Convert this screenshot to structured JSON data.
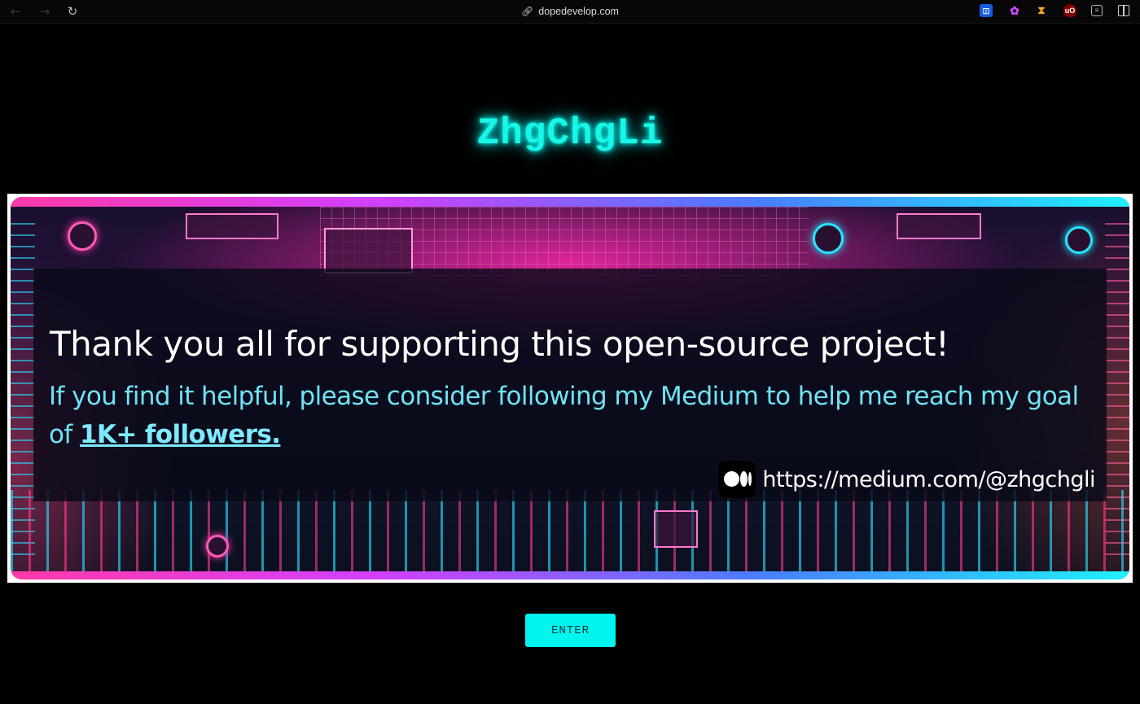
{
  "browser": {
    "back_icon": "arrow-left-icon",
    "forward_icon": "arrow-right-icon",
    "reload_icon": "reload-icon",
    "url": "dopedevelop.com",
    "extensions": [
      "bitwarden-icon",
      "brain-icon",
      "rss-icon",
      "ublock-icon",
      "extensions-icon",
      "sidebar-icon"
    ],
    "ublock_label": "uO"
  },
  "page": {
    "title": "ZhgChgLi",
    "title_color": "#19f5e6",
    "background": "#000000"
  },
  "banner": {
    "headline": "Thank you all for supporting this open-source project!",
    "subline": "If you find it helpful, please consider following my Medium to help me reach my goal of",
    "subline_emphasis": "1K+ followers.",
    "medium_url": "https://medium.com/@zhgchgli",
    "accent_pink": "#ff3aa8",
    "accent_cyan": "#1ef1ff"
  },
  "enter_button": {
    "label": "ENTER",
    "color": "#00f5ee"
  }
}
